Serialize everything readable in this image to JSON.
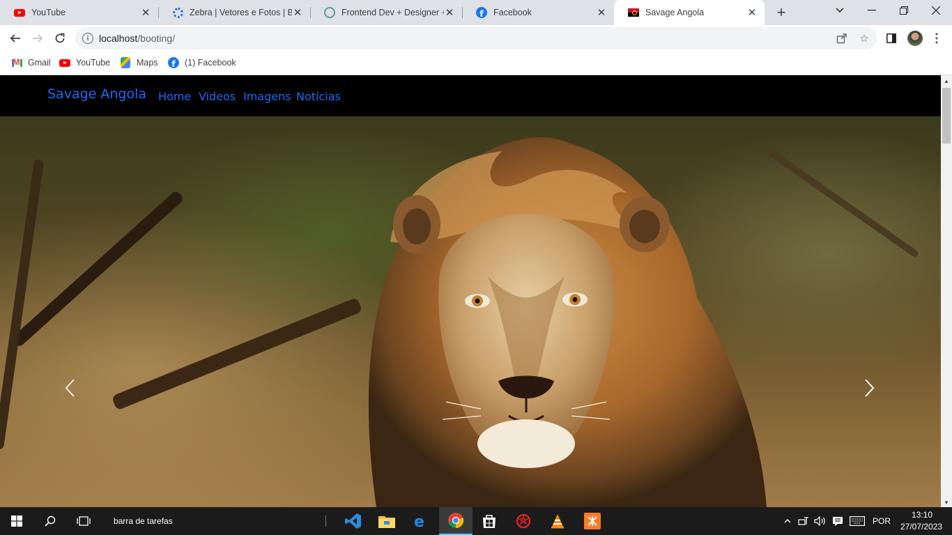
{
  "browser": {
    "tabs": [
      {
        "title": "YouTube",
        "icon": "youtube-icon",
        "active": false
      },
      {
        "title": "Zebra | Vetores e Fotos | Baix",
        "icon": "freepik-icon",
        "active": false
      },
      {
        "title": "Frontend Dev + Designer + M",
        "icon": "chatgpt-icon",
        "active": false
      },
      {
        "title": "Facebook",
        "icon": "facebook-icon",
        "active": false
      },
      {
        "title": "Savage Angola",
        "icon": "angola-flag-icon",
        "active": true
      }
    ],
    "address": {
      "host": "localhost",
      "path": "/booting/"
    },
    "bookmarks": [
      {
        "label": "Gmail",
        "icon": "gmail-icon"
      },
      {
        "label": "YouTube",
        "icon": "youtube-icon"
      },
      {
        "label": "Maps",
        "icon": "maps-icon"
      },
      {
        "label": "(1) Facebook",
        "icon": "facebook-icon"
      }
    ]
  },
  "site": {
    "brand": "Savage Angola",
    "nav": [
      "Home",
      "Videos",
      "Imagens",
      "Notícias"
    ],
    "link_color": "#1a6bf5",
    "carousel": {
      "slide": "lion-photo",
      "prev_icon": "chevron-left-icon",
      "next_icon": "chevron-right-icon"
    }
  },
  "taskbar": {
    "search_text": "barra de tarefas",
    "apps": [
      {
        "name": "vscode-icon",
        "active": false
      },
      {
        "name": "file-explorer-icon",
        "active": false
      },
      {
        "name": "edge-icon",
        "active": false
      },
      {
        "name": "chrome-icon",
        "active": true
      },
      {
        "name": "store-icon",
        "active": false
      },
      {
        "name": "antivirus-icon",
        "active": false
      },
      {
        "name": "vlc-icon",
        "active": false
      },
      {
        "name": "xampp-icon",
        "active": false
      }
    ],
    "language": "POR",
    "time": "13:10",
    "date": "27/07/2023"
  }
}
